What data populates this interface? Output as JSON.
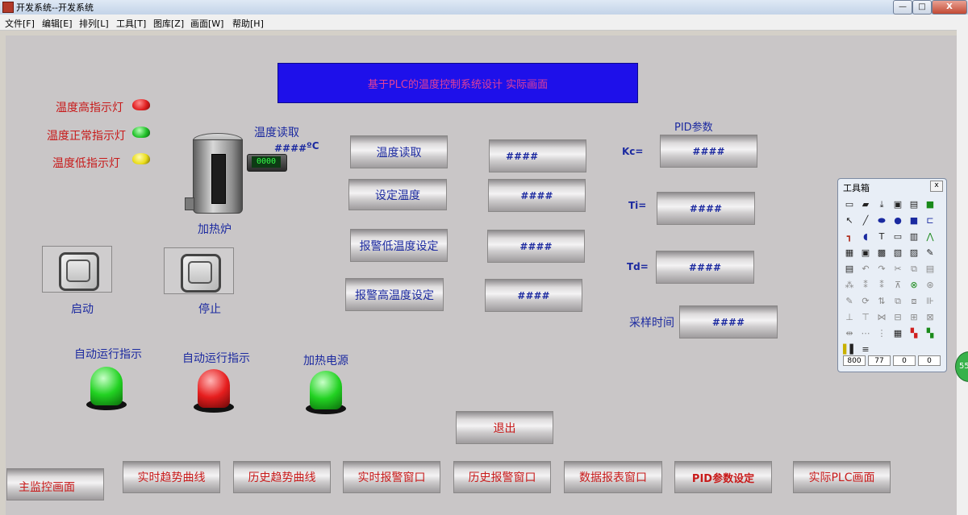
{
  "window": {
    "title": "开发系统--开发系统",
    "min": "—",
    "restore": "□",
    "close": "X"
  },
  "menu": [
    "文件[F]",
    "编辑[E]",
    "排列[L]",
    "工具[T]",
    "图库[Z]",
    "画面[W]",
    "帮助[H]"
  ],
  "banner": "基于PLC的温度控制系统设计  实际画面",
  "indicators": [
    {
      "label": "温度高指示灯",
      "color": "#e02020"
    },
    {
      "label": "温度正常指示灯",
      "color": "#22c22a"
    },
    {
      "label": "温度低指示灯",
      "color": "#eadd1a"
    }
  ],
  "furnace": {
    "top_label": "温度读取",
    "value": "####",
    "unit": "ºC",
    "display": "0000",
    "label": "加热炉"
  },
  "controls": {
    "start": "启动",
    "stop": "停止"
  },
  "lamps": [
    {
      "label": "自动运行指示",
      "color": "#22d222"
    },
    {
      "label": "自动运行指示",
      "color": "#e61e1e"
    },
    {
      "label": "加热电源",
      "color": "#22d222"
    }
  ],
  "params": [
    {
      "label": "温度读取",
      "value": "####"
    },
    {
      "label": "设定温度",
      "value": "####"
    },
    {
      "label": "报警低温度设定",
      "value": "####"
    },
    {
      "label": "报警高温度设定",
      "value": "####"
    }
  ],
  "pid": {
    "title": "PID参数",
    "kc": {
      "label": "Kc=",
      "value": "####"
    },
    "ti": {
      "label": "Ti=",
      "value": "####"
    },
    "td": {
      "label": "Td=",
      "value": "####"
    },
    "sample": {
      "label": "采样时间",
      "value": "####"
    }
  },
  "exit": "退出",
  "nav": [
    "主监控画面",
    "实时趋势曲线",
    "历史趋势曲线",
    "实时报警窗口",
    "历史报警窗口",
    "数据报表窗口",
    "PID参数设定",
    "实际PLC画面"
  ],
  "toolbox": {
    "title": "工具箱",
    "close": "x",
    "fields": [
      "800",
      "77",
      "0",
      "0"
    ]
  },
  "badge": "55"
}
